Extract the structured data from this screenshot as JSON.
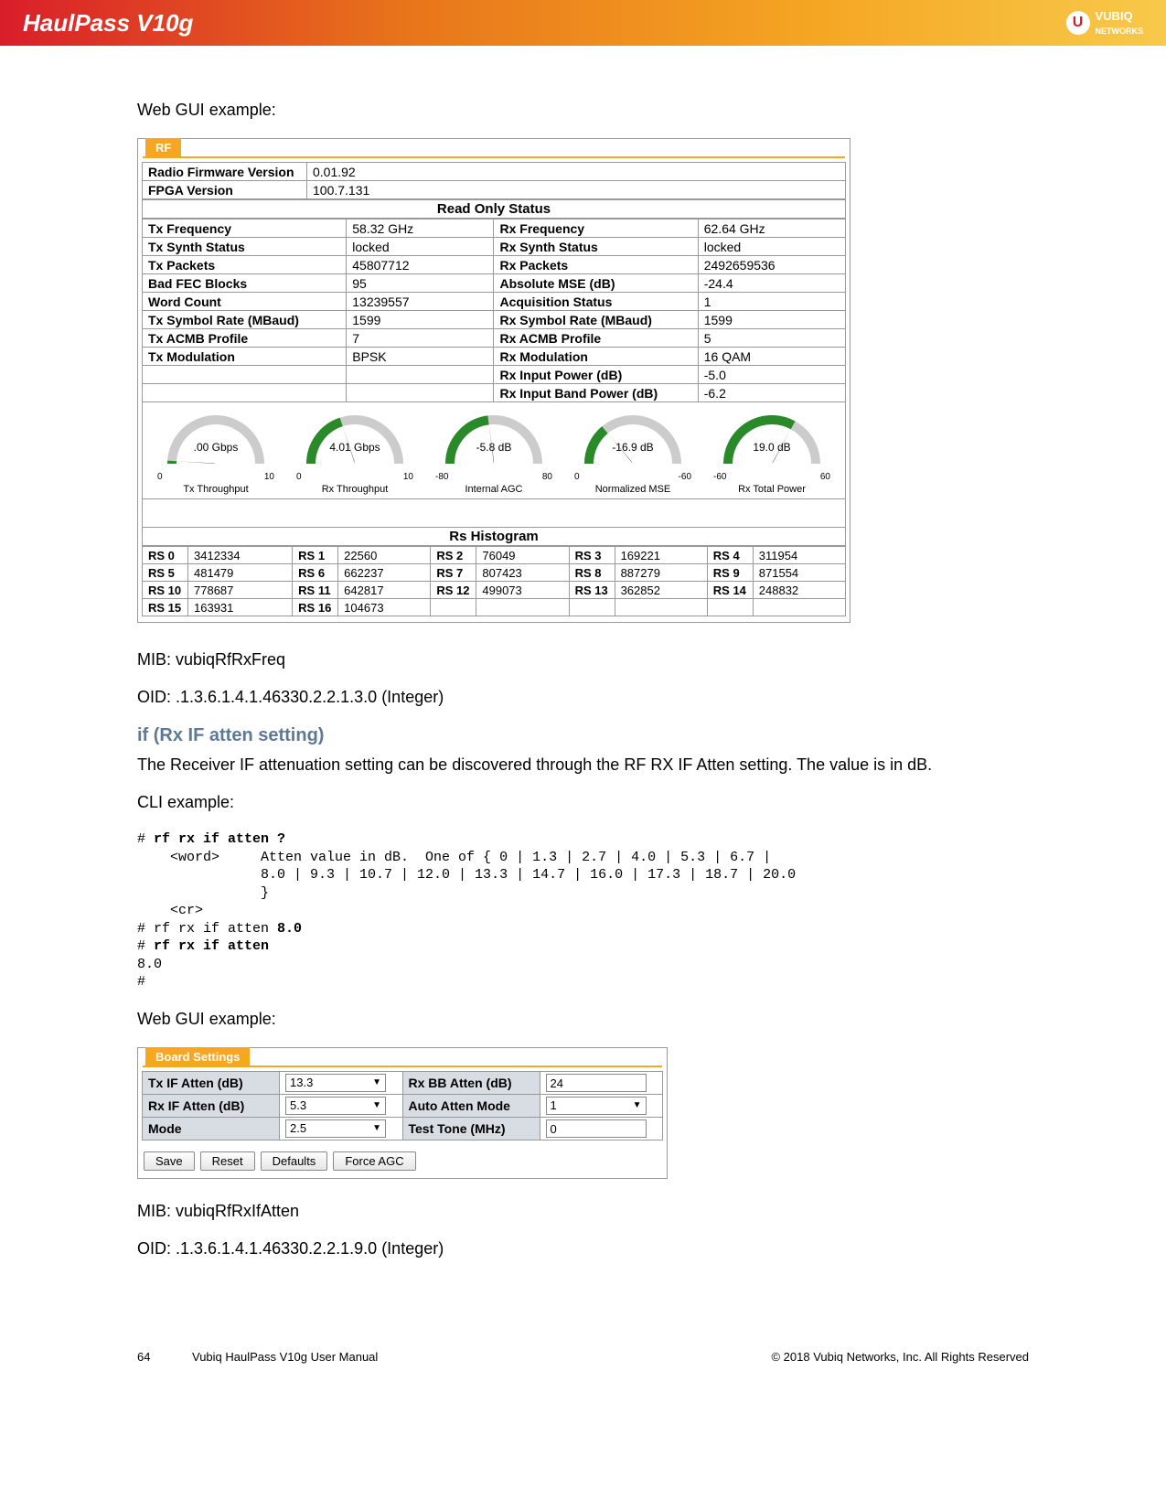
{
  "header": {
    "product": "HaulPass V10g",
    "brand_top": "VUBIQ",
    "brand_bottom": "NETWORKS"
  },
  "intro1": "Web GUI example:",
  "rf": {
    "tab": "RF",
    "rows_top": [
      {
        "l": "Radio Firmware Version",
        "v": "0.01.92"
      },
      {
        "l": "FPGA Version",
        "v": "100.7.131"
      }
    ],
    "ro_header": "Read Only Status",
    "rows_left": [
      {
        "l": "Tx Frequency",
        "v": "58.32 GHz"
      },
      {
        "l": "Tx Synth Status",
        "v": "locked"
      },
      {
        "l": "Tx Packets",
        "v": "45807712"
      },
      {
        "l": "Bad FEC Blocks",
        "v": "95"
      },
      {
        "l": "Word Count",
        "v": "13239557"
      },
      {
        "l": "Tx Symbol Rate (MBaud)",
        "v": "1599"
      },
      {
        "l": "Tx ACMB Profile",
        "v": "7"
      },
      {
        "l": "Tx Modulation",
        "v": "BPSK"
      }
    ],
    "rows_right": [
      {
        "l": "Rx Frequency",
        "v": "62.64 GHz"
      },
      {
        "l": "Rx Synth Status",
        "v": "locked"
      },
      {
        "l": "Rx Packets",
        "v": "2492659536"
      },
      {
        "l": "Absolute MSE (dB)",
        "v": "-24.4"
      },
      {
        "l": "Acquisition Status",
        "v": "1"
      },
      {
        "l": "Rx Symbol Rate (MBaud)",
        "v": "1599"
      },
      {
        "l": "Rx ACMB Profile",
        "v": "5"
      },
      {
        "l": "Rx Modulation",
        "v": "16 QAM"
      },
      {
        "l": "Rx Input Power (dB)",
        "v": "-5.0"
      },
      {
        "l": "Rx Input Band Power (dB)",
        "v": "-6.2"
      }
    ],
    "gauges": [
      {
        "val": ".00 Gbps",
        "min": "0",
        "max": "10",
        "label": "Tx Throughput",
        "frac": 0.02
      },
      {
        "val": "4.01 Gbps",
        "min": "0",
        "max": "10",
        "label": "Rx Throughput",
        "frac": 0.4
      },
      {
        "val": "-5.8 dB",
        "min": "-80",
        "max": "80",
        "label": "Internal AGC",
        "frac": 0.46
      },
      {
        "val": "-16.9 dB",
        "min": "0",
        "max": "-60",
        "label": "Normalized MSE",
        "frac": 0.28
      },
      {
        "val": "19.0 dB",
        "min": "-60",
        "max": "60",
        "label": "Rx Total Power",
        "frac": 0.66
      }
    ],
    "hist_header": "Rs Histogram",
    "hist": [
      [
        "RS 0",
        "3412334",
        "RS 1",
        "22560",
        "RS 2",
        "76049",
        "RS 3",
        "169221",
        "RS 4",
        "311954"
      ],
      [
        "RS 5",
        "481479",
        "RS 6",
        "662237",
        "RS 7",
        "807423",
        "RS 8",
        "887279",
        "RS 9",
        "871554"
      ],
      [
        "RS 10",
        "778687",
        "RS 11",
        "642817",
        "RS 12",
        "499073",
        "RS 13",
        "362852",
        "RS 14",
        "248832"
      ],
      [
        "RS 15",
        "163931",
        "RS 16",
        "104673"
      ]
    ]
  },
  "mib1": "MIB:  vubiqRfRxFreq",
  "oid1": "OID:  .1.3.6.1.4.1.46330.2.2.1.3.0 (Integer)",
  "h3": "if (Rx IF atten setting)",
  "desc": "The Receiver IF attenuation setting can be discovered through the RF RX IF Atten setting.  The value is in dB.",
  "cli_label": "CLI example:",
  "cli": {
    "l1a": "# ",
    "l1b": "rf rx if atten ?",
    "l2": "    <word>     Atten value in dB.  One of { 0 | 1.3 | 2.7 | 4.0 | 5.3 | 6.7 |",
    "l3": "               8.0 | 9.3 | 10.7 | 12.0 | 13.3 | 14.7 | 16.0 | 17.3 | 18.7 | 20.0",
    "l4": "               }",
    "l5": "    <cr>",
    "l6a": "# rf rx if atten ",
    "l6b": "8.0",
    "l7a": "# ",
    "l7b": "rf rx if atten",
    "l8": "8.0",
    "l9": "#"
  },
  "intro2": "Web GUI example:",
  "bs": {
    "tab": "Board Settings",
    "rows": [
      {
        "l": "Tx IF Atten (dB)",
        "v": "13.3",
        "type": "select",
        "rl": "Rx BB Atten (dB)",
        "rv": "24",
        "rtype": "input"
      },
      {
        "l": "Rx IF Atten (dB)",
        "v": "5.3",
        "type": "select",
        "rl": "Auto Atten Mode",
        "rv": "1",
        "rtype": "select"
      },
      {
        "l": "Mode",
        "v": "2.5",
        "type": "select",
        "rl": "Test Tone (MHz)",
        "rv": "0",
        "rtype": "input"
      }
    ],
    "buttons": [
      "Save",
      "Reset",
      "Defaults",
      "Force AGC"
    ]
  },
  "mib2": "MIB:  vubiqRfRxIfAtten",
  "oid2": "OID:  .1.3.6.1.4.1.46330.2.2.1.9.0 (Integer)",
  "footer": {
    "page": "64",
    "title": "Vubiq HaulPass V10g User Manual",
    "copy": "© 2018 Vubiq Networks, Inc. All Rights Reserved"
  }
}
